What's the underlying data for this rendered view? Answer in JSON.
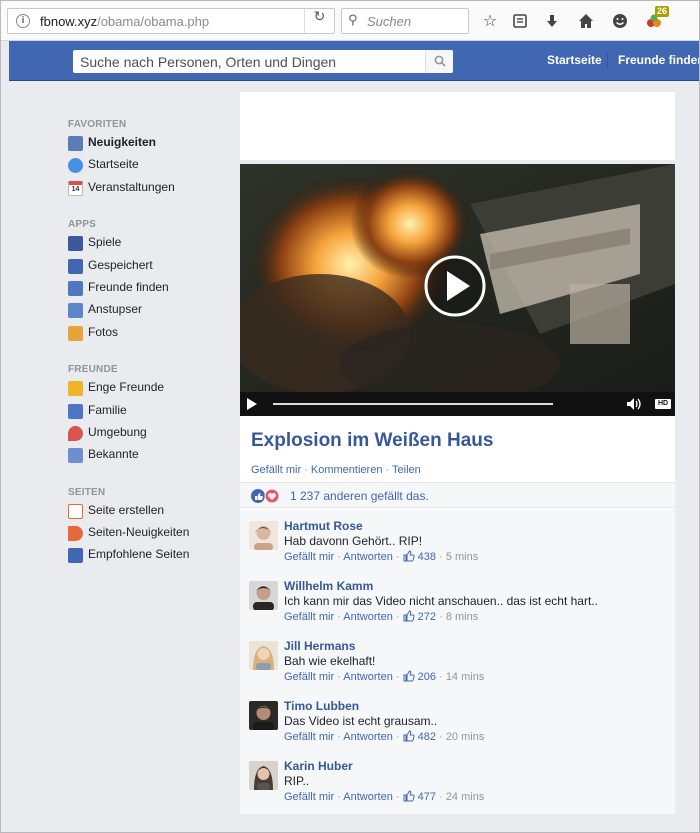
{
  "browser": {
    "url_host": "fbnow.xyz",
    "url_path": "/obama/obama.php",
    "search_placeholder": "Suchen",
    "badge_count": "26"
  },
  "fb_header": {
    "search_placeholder": "Suche nach Personen, Orten und Dingen",
    "nav_home": "Startseite",
    "nav_find_friends": "Freunde finden"
  },
  "leftnav": {
    "favorites_title": "FAVORITEN",
    "favorites": [
      {
        "label": "Neuigkeiten",
        "icon": "news-feed-icon",
        "color": "#5b7bb4"
      },
      {
        "label": "Startseite",
        "icon": "messenger-icon",
        "color": "#4a90e2"
      },
      {
        "label": "Veranstaltungen",
        "icon": "calendar-icon",
        "color": "#e04b4b"
      }
    ],
    "apps_title": "APPS",
    "apps": [
      {
        "label": "Spiele",
        "icon": "games-icon",
        "color": "#3b5998"
      },
      {
        "label": "Gespeichert",
        "icon": "bookmark-icon",
        "color": "#4267b2"
      },
      {
        "label": "Freunde finden",
        "icon": "find-friends-icon",
        "color": "#4e77c0"
      },
      {
        "label": "Anstupser",
        "icon": "poke-icon",
        "color": "#5b87c9"
      },
      {
        "label": "Fotos",
        "icon": "photos-icon",
        "color": "#e8a33a"
      }
    ],
    "friends_title": "FREUNDE",
    "friends": [
      {
        "label": "Enge Freunde",
        "icon": "star-icon",
        "color": "#f0b428"
      },
      {
        "label": "Familie",
        "icon": "family-icon",
        "color": "#4a76c2"
      },
      {
        "label": "Umgebung",
        "icon": "location-pin-icon",
        "color": "#d9534f"
      },
      {
        "label": "Bekannte",
        "icon": "acquaintances-icon",
        "color": "#6d8fcf"
      }
    ],
    "pages_title": "SEITEN",
    "pages": [
      {
        "label": "Seite erstellen",
        "icon": "create-page-icon",
        "color": "#e8683a"
      },
      {
        "label": "Seiten-Neuigkeiten",
        "icon": "megaphone-icon",
        "color": "#e8683a"
      },
      {
        "label": "Empfohlene Seiten",
        "icon": "thumbs-up-icon",
        "color": "#4267b2"
      }
    ]
  },
  "post": {
    "title": "Explosion im Weißen Haus",
    "action_like": "Gefällt mir",
    "action_comment": "Kommentieren",
    "action_share": "Teilen",
    "likes_text": "1 237 anderen gefällt das.",
    "video_badge": "HD"
  },
  "comments": [
    {
      "name": "Hartmut Rose",
      "text": "Hab davonn Gehört.. RIP!",
      "like": "Gefällt mir",
      "reply": "Antworten",
      "count": "438",
      "time": "5 mins",
      "avatar_color": "#d8b8a0"
    },
    {
      "name": "Willhelm Kamm",
      "text": "Ich kann mir das Video nicht anschauen.. das ist echt hart..",
      "like": "Gefällt mir",
      "reply": "Antworten",
      "count": "272",
      "time": "8 mins",
      "avatar_color": "#3a3532"
    },
    {
      "name": "Jill Hermans",
      "text": "Bah wie ekelhaft!",
      "like": "Gefällt mir",
      "reply": "Antworten",
      "count": "206",
      "time": "14 mins",
      "avatar_color": "#d9b17a"
    },
    {
      "name": "Timo Lubben",
      "text": "Das Video ist echt grausam..",
      "like": "Gefällt mir",
      "reply": "Antworten",
      "count": "482",
      "time": "20 mins",
      "avatar_color": "#5a4a3e"
    },
    {
      "name": "Karin Huber",
      "text": "RIP..",
      "like": "Gefällt mir",
      "reply": "Antworten",
      "count": "477",
      "time": "24 mins",
      "avatar_color": "#7a6a5e"
    }
  ]
}
